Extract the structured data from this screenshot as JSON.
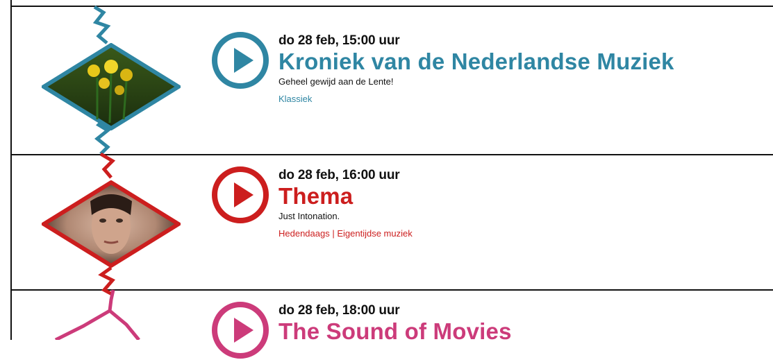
{
  "colors": {
    "klassiek": "#2f86a3",
    "hedendaags": "#cc1e1e",
    "movies": "#cc3b7a"
  },
  "items": [
    {
      "date": "do 28 feb, 15:00 uur",
      "title": "Kroniek van de Nederlandse Muziek",
      "description": "Geheel gewijd aan de Lente!",
      "genre": "Klassiek"
    },
    {
      "date": "do 28 feb, 16:00 uur",
      "title": "Thema",
      "description": "Just Intonation.",
      "genre": "Hedendaags | Eigentijdse muziek"
    },
    {
      "date": "do 28 feb, 18:00 uur",
      "title": "The Sound of Movies"
    }
  ],
  "icons": {
    "play": "play-icon"
  }
}
